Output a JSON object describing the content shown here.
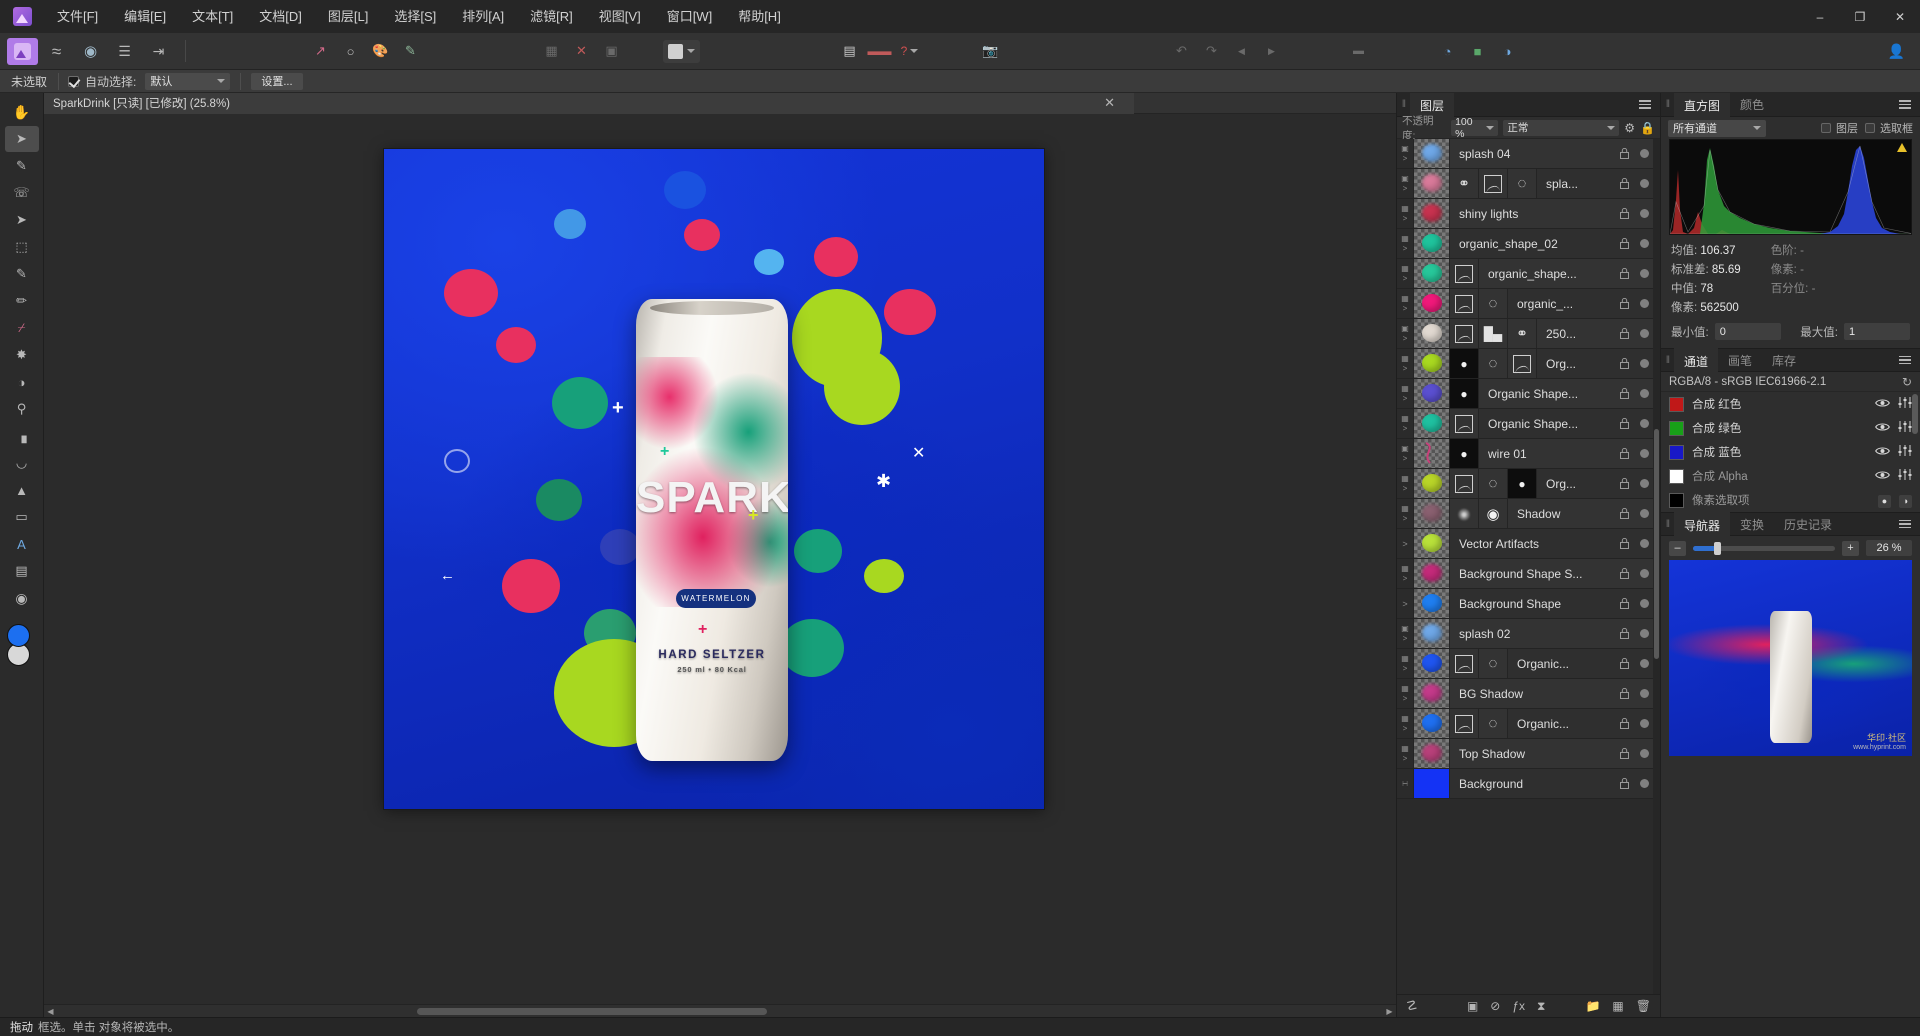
{
  "app": {
    "logo_icon": "affinity-photo-logo",
    "menus": [
      {
        "label": "文件[F]"
      },
      {
        "label": "编辑[E]"
      },
      {
        "label": "文本[T]"
      },
      {
        "label": "文档[D]"
      },
      {
        "label": "图层[L]"
      },
      {
        "label": "选择[S]"
      },
      {
        "label": "排列[A]"
      },
      {
        "label": "滤镜[R]"
      },
      {
        "label": "视图[V]"
      },
      {
        "label": "窗口[W]"
      },
      {
        "label": "帮助[H]"
      }
    ],
    "window_controls": {
      "minimize": "–",
      "maximize": "❐",
      "close": "✕"
    }
  },
  "toolbar": {
    "personas": [
      {
        "name": "photo-persona",
        "glyph": "◢",
        "active": true
      },
      {
        "name": "liquify-persona",
        "glyph": "≈",
        "active": false
      },
      {
        "name": "develop-persona",
        "glyph": "◎",
        "active": false
      },
      {
        "name": "tone-mapping-persona",
        "glyph": "≡",
        "active": false
      },
      {
        "name": "export-persona",
        "glyph": "⇥",
        "active": false
      }
    ],
    "assistants": [
      {
        "name": "assistant-curve-icon",
        "glyph": "↗"
      },
      {
        "name": "assistant-circle-icon",
        "glyph": "●"
      },
      {
        "name": "assistant-color-icon",
        "glyph": "◐"
      },
      {
        "name": "assistant-paint-icon",
        "glyph": "✎"
      }
    ],
    "snapping": [
      {
        "name": "snap-grid-icon",
        "glyph": "▦"
      },
      {
        "name": "snap-disable-icon",
        "glyph": "✕"
      },
      {
        "name": "snap-candidates-icon",
        "glyph": "▣"
      }
    ],
    "blend_pill": {
      "swatch_color": "#d0d0d0",
      "chevron": "∨"
    },
    "align": [
      {
        "name": "align-left-icon",
        "glyph": "▐"
      },
      {
        "name": "align-distribute-icon",
        "glyph": "▤"
      },
      {
        "name": "assistant-warning-icon",
        "glyph": "?"
      }
    ],
    "camera_icon": "camera-raw-icon",
    "history_icons": [
      {
        "name": "undo-icon",
        "glyph": "↶"
      },
      {
        "name": "redo-icon",
        "glyph": "↷"
      },
      {
        "name": "step-back-icon",
        "glyph": "◀"
      },
      {
        "name": "step-forward-icon",
        "glyph": "▶"
      }
    ],
    "share_icons": [
      {
        "name": "color-wheel-icon",
        "glyph": "◔"
      },
      {
        "name": "swatches-icon",
        "glyph": "■"
      },
      {
        "name": "stock-icon",
        "glyph": "◑"
      }
    ],
    "avatar_icon": "user-account-icon"
  },
  "context_bar": {
    "selection_state": "未选取",
    "auto_select_label": "自动选择:",
    "auto_select_checked": true,
    "mode_value": "默认",
    "settings_label": "设置..."
  },
  "tools": [
    {
      "name": "tool-move",
      "glyph": "✣",
      "selected": false
    },
    {
      "name": "tool-pointer",
      "glyph": "➤",
      "selected": true
    },
    {
      "name": "tool-pen",
      "glyph": "✒",
      "selected": false
    },
    {
      "name": "tool-crop",
      "glyph": "⌗",
      "selected": false
    },
    {
      "name": "tool-node",
      "glyph": "↖",
      "selected": false
    },
    {
      "name": "tool-marquee",
      "glyph": "⬚",
      "selected": false
    },
    {
      "name": "tool-selection-brush",
      "glyph": "✐",
      "selected": false
    },
    {
      "name": "tool-paint-brush",
      "glyph": "✏",
      "selected": false
    },
    {
      "name": "tool-eraser",
      "glyph": "⌫",
      "selected": false
    },
    {
      "name": "tool-clone",
      "glyph": "❈",
      "selected": false
    },
    {
      "name": "tool-dodge",
      "glyph": "◑",
      "selected": false
    },
    {
      "name": "tool-zoom",
      "glyph": "⚲",
      "selected": false
    },
    {
      "name": "tool-gradient",
      "glyph": "▧",
      "selected": false
    },
    {
      "name": "tool-color-picker",
      "glyph": "⚗",
      "selected": false
    },
    {
      "name": "tool-flood-fill",
      "glyph": "▲",
      "selected": false
    },
    {
      "name": "tool-shape-rect",
      "glyph": "▭",
      "selected": false
    },
    {
      "name": "tool-artistic-text",
      "glyph": "A",
      "selected": false
    },
    {
      "name": "tool-frame-text",
      "glyph": "▤",
      "selected": false
    },
    {
      "name": "tool-mesh-warp",
      "glyph": "◉",
      "selected": false
    }
  ],
  "swatches": {
    "foreground": "#1c6ff0",
    "background": "#d8d8d8"
  },
  "document": {
    "tab_title": "SparkDrink [只读] [已修改] (25.8%)",
    "close_glyph": "✕",
    "canvas": {
      "brand": "SPARK",
      "flavor_badge": "WATERMELON",
      "subtitle": "HARD SELTZER",
      "volume": "250 ml • 80 Kcal"
    }
  },
  "layers_panel": {
    "tabs": [
      {
        "label": "图层",
        "active": true
      }
    ],
    "opacity_label": "不透明度:",
    "opacity_value": "100 %",
    "blend_mode": "正常",
    "gear_icon": "gear-icon",
    "lock_icon": "lock-icon",
    "rows": [
      {
        "name": "splash 04",
        "stripe": "#3a78c8",
        "thumb": "#6fa8e8",
        "kind": "pixel",
        "fx": [],
        "gutter": "mask"
      },
      {
        "name": "spla...",
        "stripe": "#3a78c8",
        "thumb": "#d97a9a",
        "kind": "pixel",
        "fx": [
          "vector",
          "curve",
          "sphere"
        ],
        "gutter": "mask"
      },
      {
        "name": "shiny lights",
        "stripe": "#d08a23",
        "thumb": "#c8324f",
        "kind": "pixel",
        "fx": [],
        "gutter": "fx"
      },
      {
        "name": "organic_shape_02",
        "stripe": "#8b6fd4",
        "thumb": "#1fc39c",
        "kind": "shape",
        "fx": [],
        "gutter": "fx"
      },
      {
        "name": "organic_shape...",
        "stripe": "#8b6fd4",
        "thumb": "#27c79a",
        "kind": "shape",
        "fx": [
          "curve"
        ],
        "gutter": "fx"
      },
      {
        "name": "organic_...",
        "stripe": "#8b6fd4",
        "thumb": "#f0197a",
        "kind": "shape",
        "fx": [
          "curve",
          "sphere"
        ],
        "gutter": "fx"
      },
      {
        "name": "250...",
        "stripe": "#8b6fd4",
        "thumb": "#e0d8d0",
        "kind": "group",
        "fx": [
          "curve",
          "levels",
          "vector"
        ],
        "gutter": "mask"
      },
      {
        "name": "Org...",
        "stripe": "#8b6fd4",
        "thumb": "#a8d820",
        "kind": "shape",
        "fx": [
          "mask",
          "sphere",
          "curve"
        ],
        "gutter": "fx"
      },
      {
        "name": "Organic Shape...",
        "stripe": "#8b6fd4",
        "thumb": "#5a4fd0",
        "kind": "shape",
        "fx": [
          "mask"
        ],
        "gutter": "fx"
      },
      {
        "name": "Organic Shape...",
        "stripe": "#8b6fd4",
        "thumb": "#1fc0a0",
        "kind": "shape",
        "fx": [
          "curve"
        ],
        "gutter": "fx"
      },
      {
        "name": "wire 01",
        "stripe": "#8b6fd4",
        "thumb": "#c8407a",
        "kind": "curve",
        "fx": [
          "mask"
        ],
        "gutter": "mask"
      },
      {
        "name": "Org...",
        "stripe": "#8b6fd4",
        "thumb": "#b8d428",
        "kind": "shape",
        "fx": [
          "curve",
          "sphere",
          "mask"
        ],
        "gutter": "fx"
      },
      {
        "name": "Shadow",
        "stripe": "#8db832",
        "thumb": "#8a6070",
        "kind": "pixel",
        "fx": [
          "blur",
          "glow"
        ],
        "gutter": "fx"
      },
      {
        "name": "Vector Artifacts",
        "stripe": "#8db832",
        "thumb": "#b8e03a",
        "kind": "group",
        "fx": [],
        "gutter": "arrow"
      },
      {
        "name": "Background Shape S...",
        "stripe": "#8b6fd4",
        "thumb": "#c42a7a",
        "kind": "pixel",
        "fx": [],
        "gutter": "fx"
      },
      {
        "name": "Background Shape",
        "stripe": "#8b6fd4",
        "thumb": "#1f7ef0",
        "kind": "shape",
        "fx": [],
        "gutter": "arrow"
      },
      {
        "name": "splash 02",
        "stripe": "#3a78c8",
        "thumb": "#6fa8e8",
        "kind": "pixel",
        "fx": [],
        "gutter": "mask"
      },
      {
        "name": "Organic...",
        "stripe": "#8b6fd4",
        "thumb": "#1f55f0",
        "kind": "shape",
        "fx": [
          "curve",
          "sphere"
        ],
        "gutter": "fx"
      },
      {
        "name": "BG Shadow",
        "stripe": "#8db832",
        "thumb": "#c43a8a",
        "kind": "pixel",
        "fx": [],
        "gutter": "fx"
      },
      {
        "name": "Organic...",
        "stripe": "#8b6fd4",
        "thumb": "#1f6ff0",
        "kind": "shape",
        "fx": [
          "curve",
          "sphere"
        ],
        "gutter": "fx"
      },
      {
        "name": "Top Shadow",
        "stripe": "#8db832",
        "thumb": "#b8407a",
        "kind": "pixel",
        "fx": [],
        "gutter": "fx"
      },
      {
        "name": "Background",
        "stripe": "#2e2e2e",
        "thumb": "#1433f5",
        "kind": "pixel-solid",
        "fx": [],
        "gutter": "pixel"
      }
    ],
    "bottom_icons": [
      {
        "name": "layer-mode-icon",
        "glyph": "◱"
      },
      {
        "name": "add-mask-icon",
        "glyph": "●"
      },
      {
        "name": "adjustment-icon",
        "glyph": "⊘"
      },
      {
        "name": "live-filter-icon",
        "glyph": "ƒx"
      },
      {
        "name": "hourglass-icon",
        "glyph": "⧖"
      },
      {
        "name": "new-group-icon",
        "glyph": "▭"
      },
      {
        "name": "new-pixel-layer-icon",
        "glyph": "▦"
      },
      {
        "name": "delete-layer-icon",
        "glyph": "🗑"
      }
    ]
  },
  "histogram_panel": {
    "tabs": [
      {
        "label": "直方图",
        "active": true
      },
      {
        "label": "颜色",
        "active": false
      }
    ],
    "channel_select": "所有通道",
    "checkbox_layer": "图层",
    "checkbox_marquee": "选取框",
    "stats_left": [
      {
        "key": "均值:",
        "value": "106.37"
      },
      {
        "key": "标准差:",
        "value": "85.69"
      },
      {
        "key": "中值:",
        "value": "78"
      },
      {
        "key": "像素:",
        "value": "562500"
      }
    ],
    "stats_right": [
      {
        "key": "色阶:",
        "value": "-"
      },
      {
        "key": "像素:",
        "value": "-"
      },
      {
        "key": "百分位:",
        "value": "-"
      }
    ],
    "min_label": "最小值:",
    "min_value": "0",
    "max_label": "最大值:",
    "max_value": "1"
  },
  "channels_panel": {
    "tabs": [
      {
        "label": "通道",
        "active": true
      },
      {
        "label": "画笔",
        "active": false
      },
      {
        "label": "库存",
        "active": false
      }
    ],
    "colorspace": "RGBA/8 - sRGB IEC61966-2.1",
    "reset_icon": "refresh-icon",
    "rows": [
      {
        "label": "合成 红色",
        "thumb": "#c01818",
        "dim": false
      },
      {
        "label": "合成 绿色",
        "thumb": "#18a018",
        "dim": false
      },
      {
        "label": "合成 蓝色",
        "thumb": "#1818c8",
        "dim": false
      },
      {
        "label": "合成 Alpha",
        "thumb": "#ffffff",
        "dim": true
      },
      {
        "label": "像素选取项",
        "thumb": "#000000",
        "dim": true
      }
    ]
  },
  "navigator_panel": {
    "tabs": [
      {
        "label": "导航器",
        "active": true
      },
      {
        "label": "变换",
        "active": false
      },
      {
        "label": "历史记录",
        "active": false
      }
    ],
    "zoom_out": "–",
    "zoom_in": "+",
    "zoom_value": "26 %",
    "watermark": "华印·社区",
    "watermark_sub": "www.hyprint.com"
  },
  "status_bar": {
    "hint_action": "拖动",
    "hint_text": "框选。单击 对象将被选中。"
  },
  "colors": {
    "accent": "#b07be8",
    "panel_bg": "#2e2e2e",
    "row_bg": "#333333",
    "canvas_bg": "#2b2b2b"
  }
}
